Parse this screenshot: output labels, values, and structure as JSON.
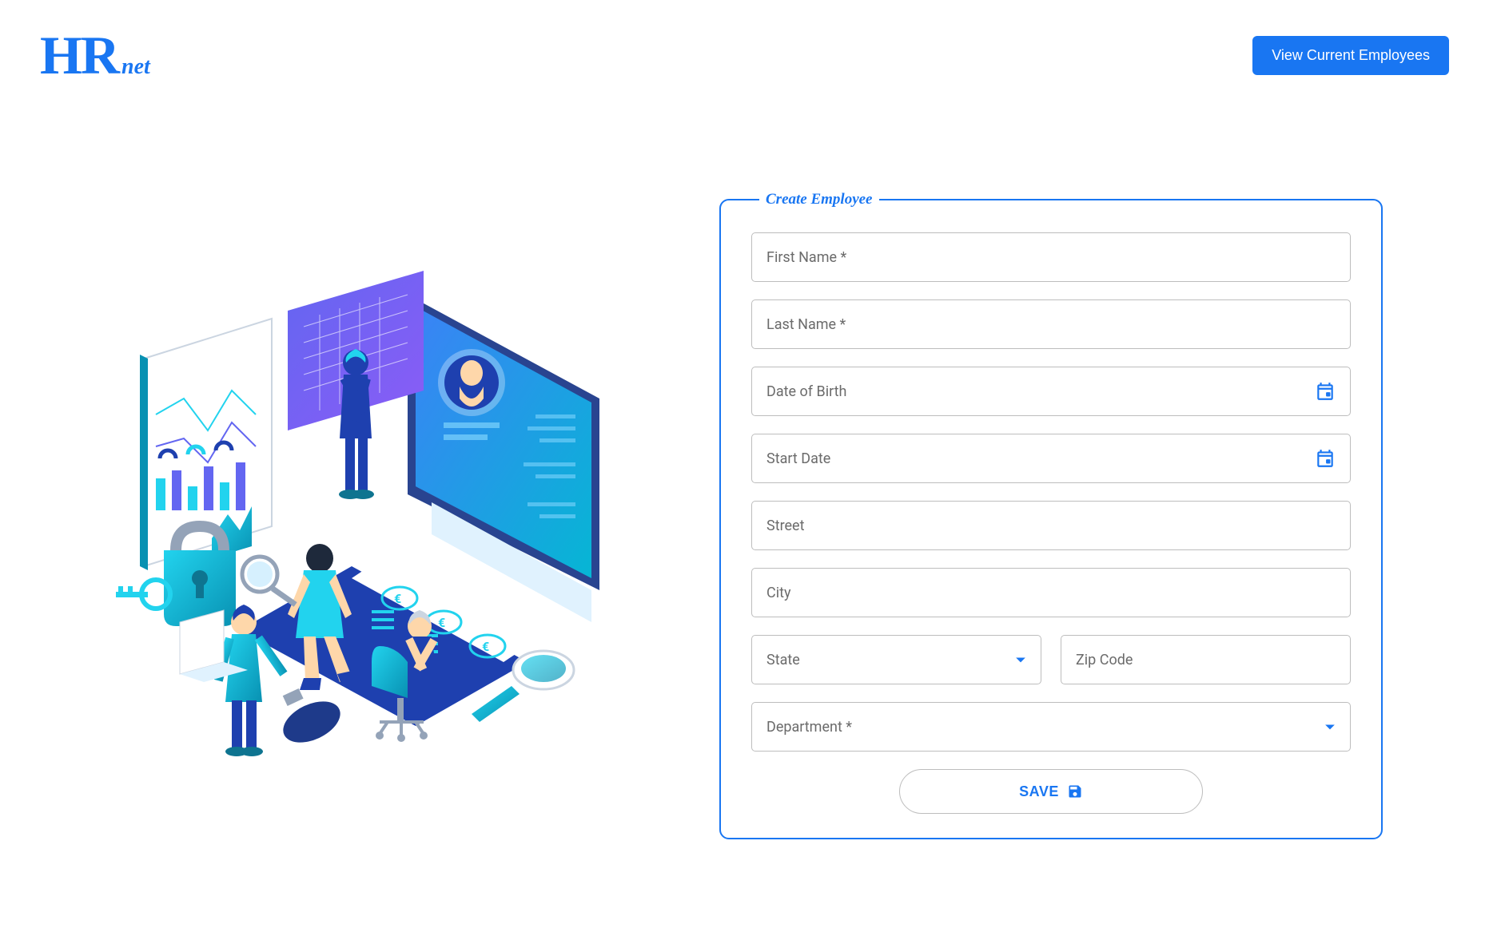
{
  "header": {
    "logo_hr": "HR",
    "logo_net": "net",
    "view_employees_label": "View Current Employees"
  },
  "form": {
    "legend": "Create Employee",
    "fields": {
      "first_name_label": "First Name *",
      "last_name_label": "Last Name *",
      "dob_label": "Date of Birth",
      "start_date_label": "Start Date",
      "street_label": "Street",
      "city_label": "City",
      "state_label": "State",
      "zip_label": "Zip Code",
      "department_label": "Department *"
    },
    "save_label": "SAVE"
  },
  "colors": {
    "primary": "#1976f2"
  }
}
